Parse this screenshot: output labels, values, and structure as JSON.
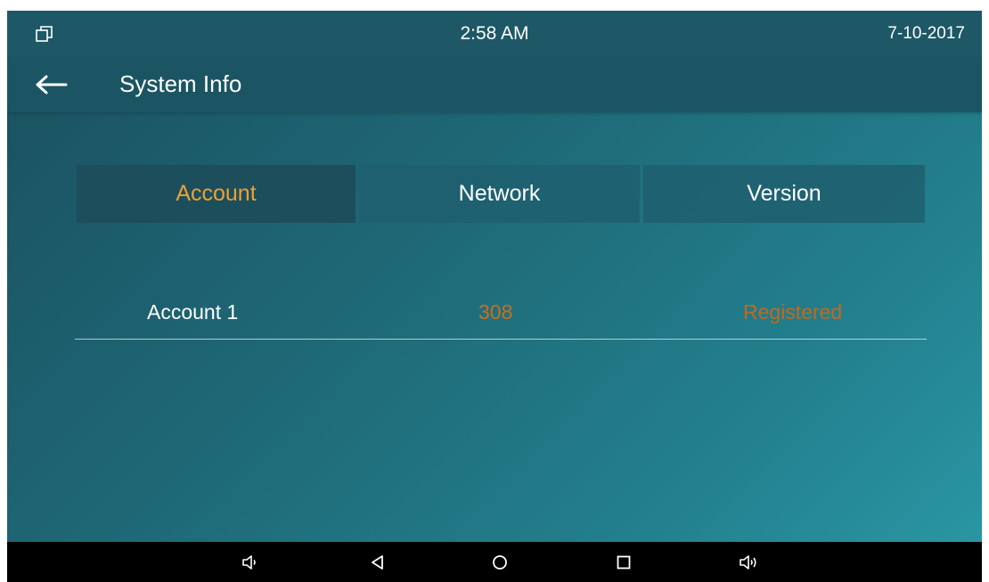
{
  "status_bar": {
    "time": "2:58 AM",
    "date": "7-10-2017",
    "left_icon": "window-restore-icon"
  },
  "title_bar": {
    "back_icon": "arrow-left-icon",
    "title": "System Info"
  },
  "tabs": [
    {
      "label": "Account",
      "selected": true
    },
    {
      "label": "Network",
      "selected": false
    },
    {
      "label": "Version",
      "selected": false
    }
  ],
  "accounts": [
    {
      "name": "Account 1",
      "number": "308",
      "status": "Registered"
    }
  ],
  "nav_bar": {
    "icons": [
      "volume-down-icon",
      "back-triangle-icon",
      "home-circle-icon",
      "recents-square-icon",
      "volume-up-icon"
    ]
  },
  "colors": {
    "accent": "#f0a033",
    "account_value": "#c8701f",
    "status_bar_bg": "#1e5866",
    "nav_bar_bg": "#000000"
  }
}
